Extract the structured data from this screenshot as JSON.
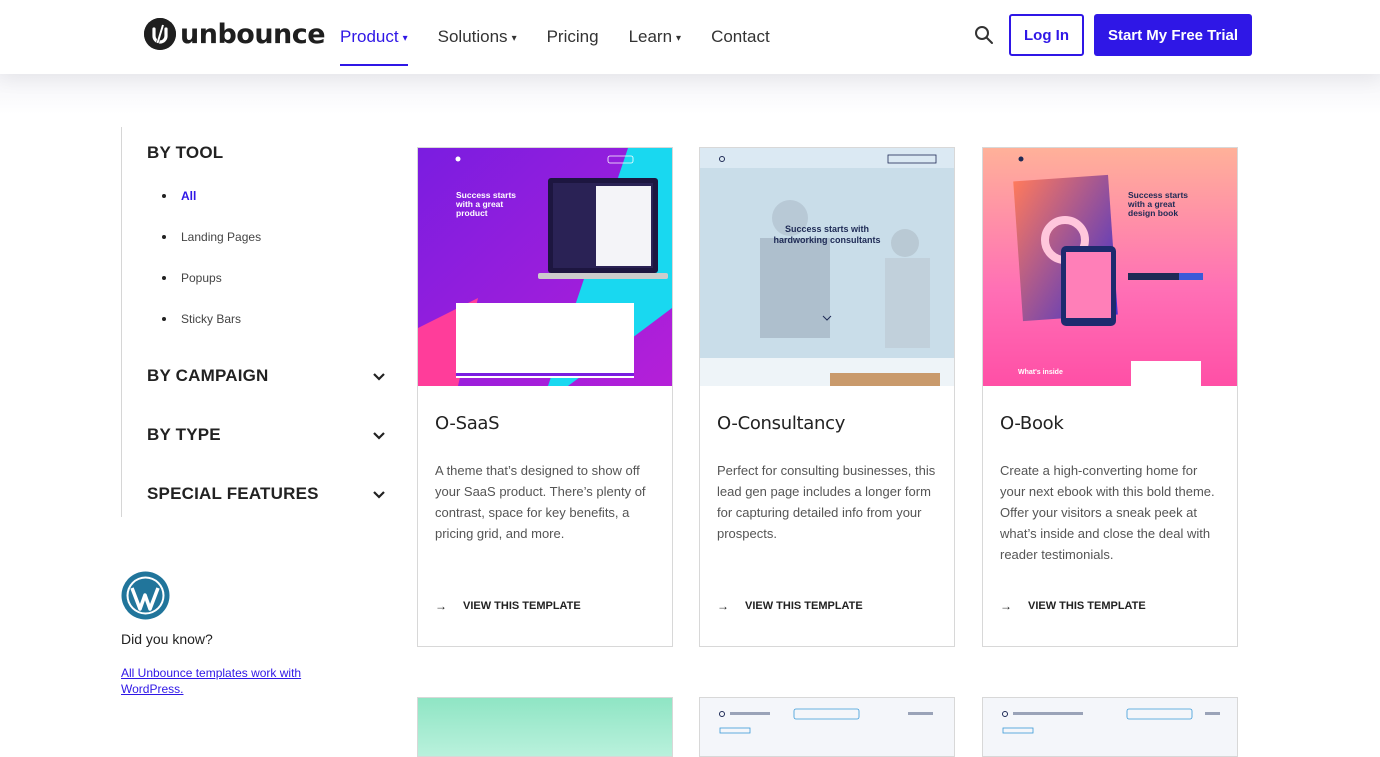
{
  "header": {
    "logo_text": "unbounce",
    "nav": [
      {
        "label": "Product",
        "active": true
      },
      {
        "label": "Solutions",
        "active": false
      },
      {
        "label": "Pricing",
        "active": false
      },
      {
        "label": "Learn",
        "active": false
      },
      {
        "label": "Contact",
        "active": false
      }
    ],
    "login_label": "Log In",
    "trial_label": "Start My Free Trial"
  },
  "sidebar": {
    "by_tool": "BY TOOL",
    "tools": [
      "All",
      "Landing Pages",
      "Popups",
      "Sticky Bars"
    ],
    "by_campaign": "BY CAMPAIGN",
    "by_type": "BY TYPE",
    "special_features": "SPECIAL FEATURES",
    "did_you_know": "Did you know?",
    "wp_link": "All Unbounce templates work with WordPress."
  },
  "cards": [
    {
      "title": "O-SaaS",
      "description": "A theme that’s designed to show off your SaaS product. There’s plenty of contrast, space for key benefits, a pricing grid, and more.",
      "cta": "VIEW THIS TEMPLATE",
      "thumb_headline": "Success starts with a great product"
    },
    {
      "title": "O-Consultancy",
      "description": "Perfect for consulting businesses, this lead gen page includes a longer form for capturing detailed info from your prospects.",
      "cta": "VIEW THIS TEMPLATE",
      "thumb_headline": "Success starts with hardworking consultants"
    },
    {
      "title": "O-Book",
      "description": "Create a high-converting home for your next ebook with this bold theme. Offer your visitors a sneak peek at what’s inside and close the deal with reader testimonials.",
      "cta": "VIEW THIS TEMPLATE",
      "thumb_headline": "Success starts with a great design book"
    }
  ],
  "colors": {
    "accent": "#2f17e6",
    "text": "#222222"
  }
}
